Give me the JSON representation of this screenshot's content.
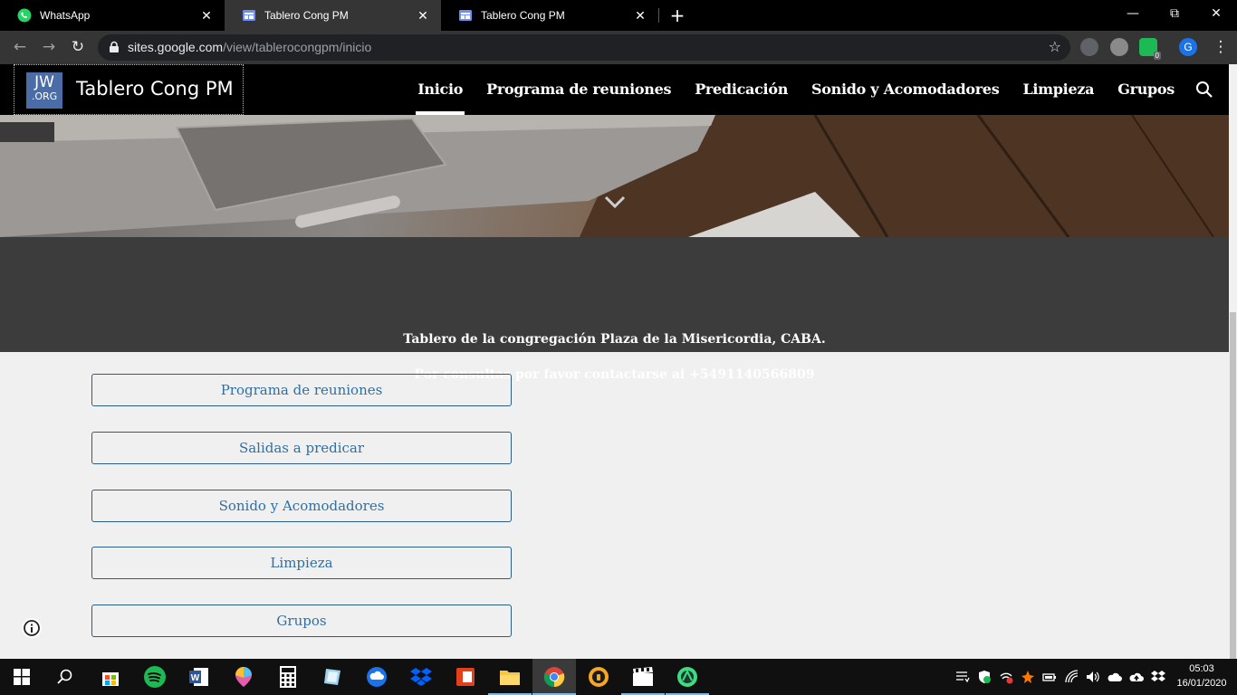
{
  "browser": {
    "tabs": [
      {
        "title": "WhatsApp",
        "icon": "whatsapp-icon"
      },
      {
        "title": "Tablero Cong PM",
        "icon": "google-sites-icon"
      },
      {
        "title": "Tablero Cong PM",
        "icon": "google-sites-icon"
      }
    ],
    "url_host": "sites.google.com",
    "url_path": "/view/tablerocongpm/inicio",
    "profile_initial": "G",
    "extension_badge": "0"
  },
  "site": {
    "logo_line1": "JW",
    "logo_line2": ".ORG",
    "title": "Tablero Cong PM",
    "nav": [
      "Inicio",
      "Programa de reuniones",
      "Predicación",
      "Sonido y Acomodadores",
      "Limpieza",
      "Grupos"
    ],
    "active_nav": "Inicio"
  },
  "intro": {
    "line1": "Tablero de la congregación Plaza de la Misericordia, CABA.",
    "line2": "Por consultas por favor contactarse al +5491140566809"
  },
  "buttons": [
    "Programa de reuniones",
    "Salidas a predicar",
    "Sonido y Acomodadores",
    "Limpieza",
    "Grupos"
  ],
  "taskbar": {
    "apps": [
      "start-icon",
      "search-icon",
      "store-icon",
      "spotify-icon",
      "word-icon",
      "paint3d-icon",
      "calculator-icon",
      "notepad-icon",
      "cloud-backup-icon",
      "dropbox-icon",
      "pdf-icon",
      "file-explorer-icon",
      "chrome-icon",
      "vpn-icon",
      "video-editor-icon",
      "android-studio-icon"
    ],
    "time": "05:03",
    "date": "16/01/2020"
  },
  "colors": {
    "chrome_dark": "#353535",
    "site_header": "#000000",
    "intro_band": "#3c3c3c",
    "button_text": "#2f6fa3",
    "page_bg": "#f0f0f0"
  }
}
